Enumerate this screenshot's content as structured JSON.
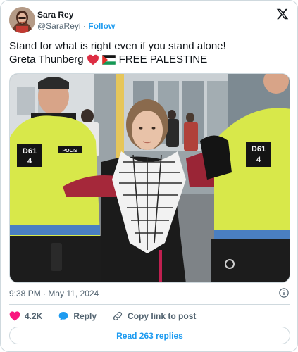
{
  "author": {
    "display_name": "Sara Rey",
    "handle": "@SaraReyi",
    "separator": "·",
    "follow_label": "Follow"
  },
  "tweet": {
    "line1": "Stand for what is right even if you stand alone!",
    "line2_prefix": "Greta Thunberg",
    "line2_suffix": "FREE PALESTINE",
    "emojis": [
      "red-heart-emoji",
      "palestine-flag-emoji"
    ]
  },
  "photo": {
    "vest_label_left": "D61",
    "vest_number_left": "4",
    "vest_brand": "POLIS",
    "vest_label_right": "D61",
    "vest_number_right": "4"
  },
  "meta": {
    "time": "9:38 PM",
    "separator": "·",
    "date": "May 11, 2024"
  },
  "actions": {
    "like_count": "4.2K",
    "reply_label": "Reply",
    "copy_label": "Copy link to post"
  },
  "read_replies_label": "Read 263 replies",
  "colors": {
    "accent": "#1d9bf0",
    "text": "#0f1419",
    "muted": "#536471",
    "border": "#cfd9de",
    "like": "#f91880",
    "vest": "#d8e84a"
  },
  "icons": [
    "x-logo-icon",
    "info-icon",
    "heart-icon",
    "reply-bubble-icon",
    "link-icon"
  ]
}
